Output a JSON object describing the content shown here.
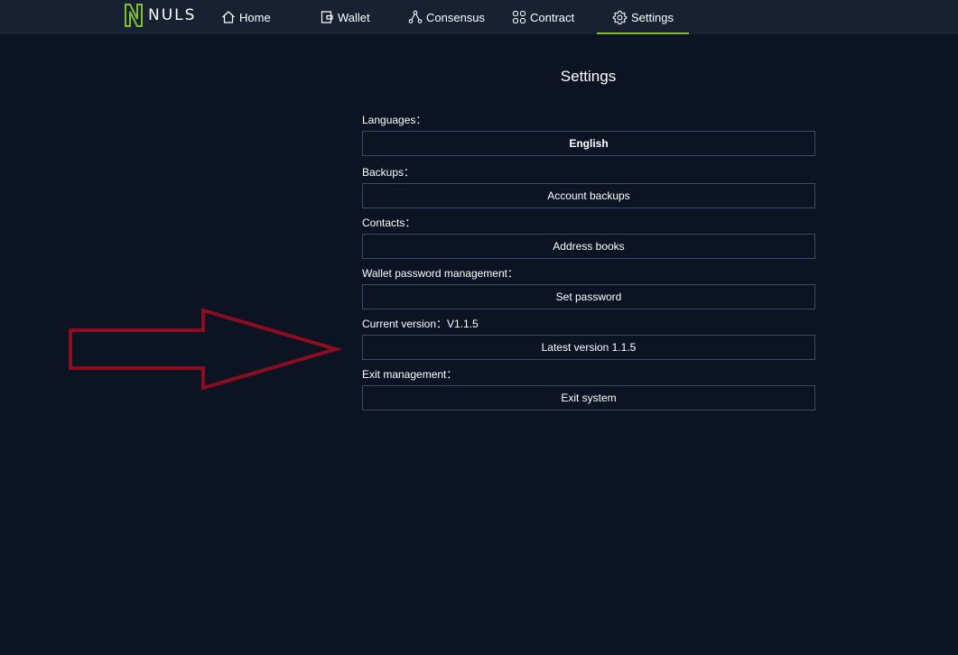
{
  "brand": {
    "name": "NULS",
    "accent_color": "#82bd39"
  },
  "nav": {
    "items": [
      {
        "label": "Home",
        "icon": "home-icon"
      },
      {
        "label": "Wallet",
        "icon": "wallet-icon"
      },
      {
        "label": "Consensus",
        "icon": "consensus-icon"
      },
      {
        "label": "Contract",
        "icon": "contract-icon"
      },
      {
        "label": "Settings",
        "icon": "gear-icon",
        "active": true
      }
    ]
  },
  "settings": {
    "title": "Settings",
    "languages_label": "Languages：",
    "languages_value": "English",
    "backups_label": "Backups：",
    "backups_button": "Account backups",
    "contacts_label": "Contacts：",
    "contacts_button": "Address books",
    "password_label": "Wallet password management：",
    "password_button": "Set password",
    "version_label": "Current version：V1.1.5",
    "version_button": "Latest version 1.1.5",
    "exit_label": "Exit management：",
    "exit_button": "Exit system"
  },
  "annotation": {
    "arrow_color": "#8b0d1f"
  }
}
